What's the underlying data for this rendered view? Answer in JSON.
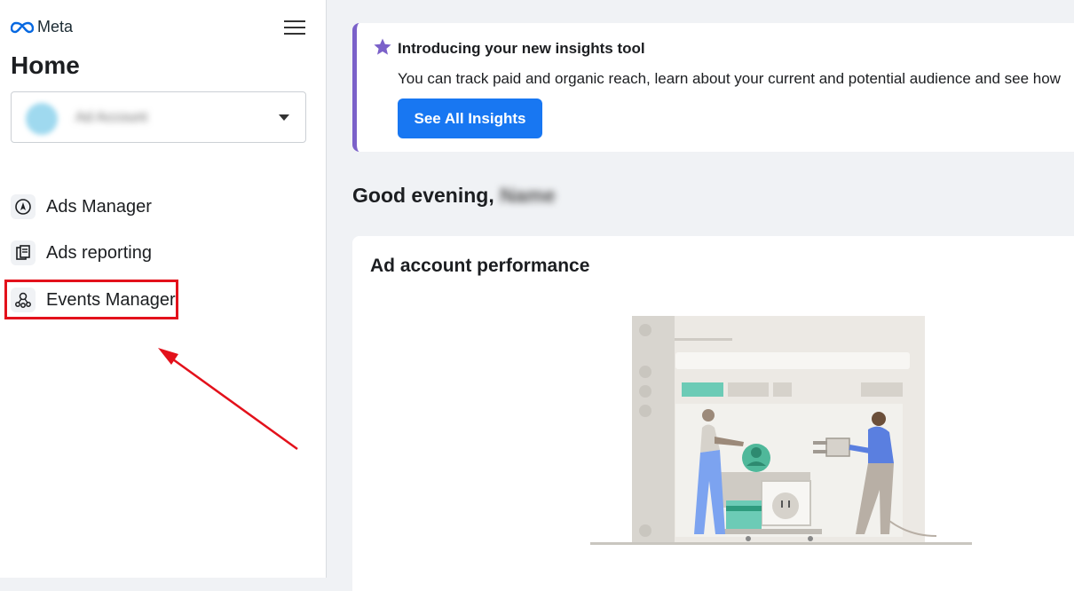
{
  "sidebar": {
    "logo": "Meta",
    "title": "Home",
    "account": {
      "name": "Ad Account"
    },
    "nav": [
      {
        "label": "Ads Manager",
        "icon": "navigation-compass-icon"
      },
      {
        "label": "Ads reporting",
        "icon": "report-pages-icon"
      },
      {
        "label": "Events Manager",
        "icon": "events-network-icon"
      }
    ]
  },
  "banner": {
    "title": "Introducing your new insights tool",
    "text": "You can track paid and organic reach, learn about your current and potential audience and see how",
    "button": "See All Insights",
    "accent": "#7b61c9"
  },
  "greeting": {
    "text": "Good evening,",
    "name": "Name"
  },
  "performance": {
    "title": "Ad account performance"
  },
  "colors": {
    "primary": "#1877f2",
    "highlight": "#e3111b"
  }
}
